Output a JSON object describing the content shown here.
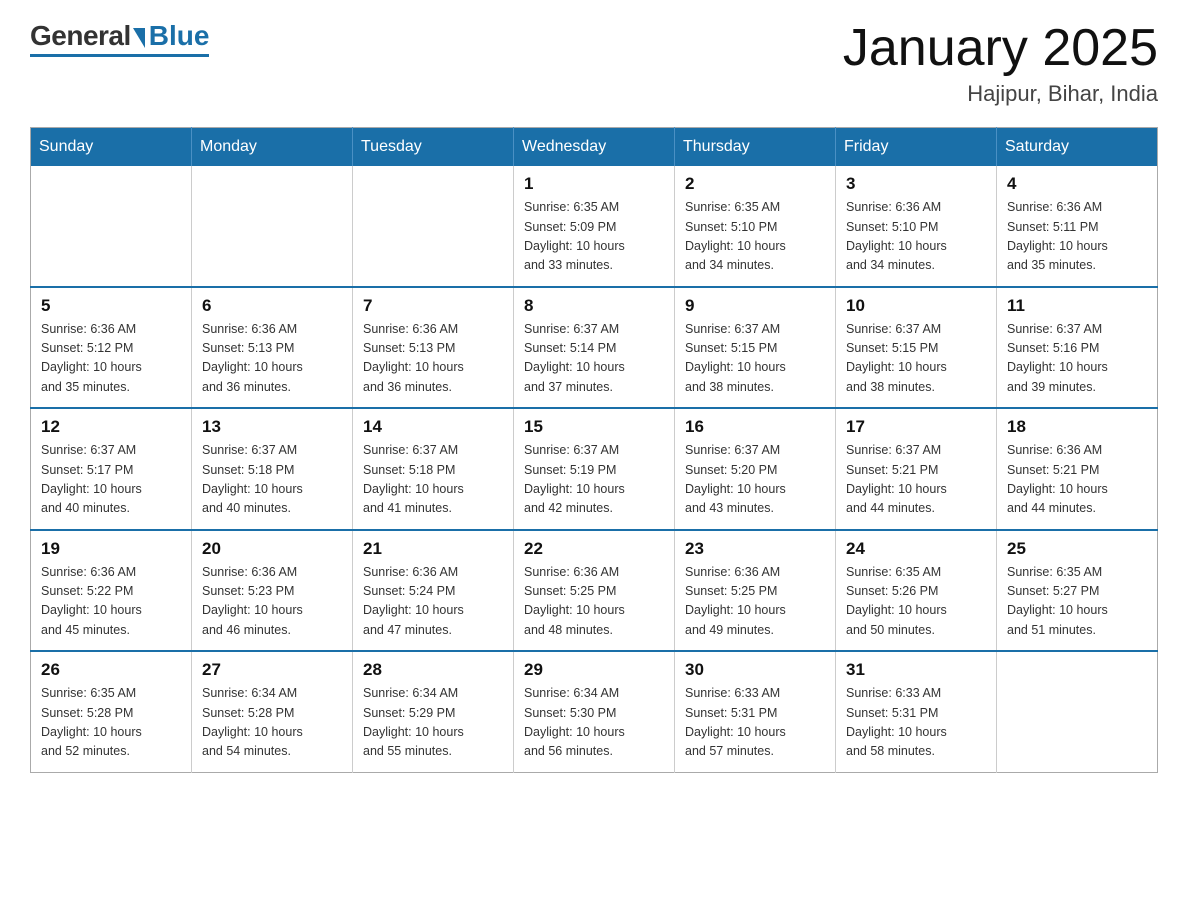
{
  "header": {
    "logo": {
      "general": "General",
      "blue": "Blue"
    },
    "title": "January 2025",
    "subtitle": "Hajipur, Bihar, India"
  },
  "calendar": {
    "days_of_week": [
      "Sunday",
      "Monday",
      "Tuesday",
      "Wednesday",
      "Thursday",
      "Friday",
      "Saturday"
    ],
    "weeks": [
      [
        {
          "day": "",
          "info": ""
        },
        {
          "day": "",
          "info": ""
        },
        {
          "day": "",
          "info": ""
        },
        {
          "day": "1",
          "info": "Sunrise: 6:35 AM\nSunset: 5:09 PM\nDaylight: 10 hours\nand 33 minutes."
        },
        {
          "day": "2",
          "info": "Sunrise: 6:35 AM\nSunset: 5:10 PM\nDaylight: 10 hours\nand 34 minutes."
        },
        {
          "day": "3",
          "info": "Sunrise: 6:36 AM\nSunset: 5:10 PM\nDaylight: 10 hours\nand 34 minutes."
        },
        {
          "day": "4",
          "info": "Sunrise: 6:36 AM\nSunset: 5:11 PM\nDaylight: 10 hours\nand 35 minutes."
        }
      ],
      [
        {
          "day": "5",
          "info": "Sunrise: 6:36 AM\nSunset: 5:12 PM\nDaylight: 10 hours\nand 35 minutes."
        },
        {
          "day": "6",
          "info": "Sunrise: 6:36 AM\nSunset: 5:13 PM\nDaylight: 10 hours\nand 36 minutes."
        },
        {
          "day": "7",
          "info": "Sunrise: 6:36 AM\nSunset: 5:13 PM\nDaylight: 10 hours\nand 36 minutes."
        },
        {
          "day": "8",
          "info": "Sunrise: 6:37 AM\nSunset: 5:14 PM\nDaylight: 10 hours\nand 37 minutes."
        },
        {
          "day": "9",
          "info": "Sunrise: 6:37 AM\nSunset: 5:15 PM\nDaylight: 10 hours\nand 38 minutes."
        },
        {
          "day": "10",
          "info": "Sunrise: 6:37 AM\nSunset: 5:15 PM\nDaylight: 10 hours\nand 38 minutes."
        },
        {
          "day": "11",
          "info": "Sunrise: 6:37 AM\nSunset: 5:16 PM\nDaylight: 10 hours\nand 39 minutes."
        }
      ],
      [
        {
          "day": "12",
          "info": "Sunrise: 6:37 AM\nSunset: 5:17 PM\nDaylight: 10 hours\nand 40 minutes."
        },
        {
          "day": "13",
          "info": "Sunrise: 6:37 AM\nSunset: 5:18 PM\nDaylight: 10 hours\nand 40 minutes."
        },
        {
          "day": "14",
          "info": "Sunrise: 6:37 AM\nSunset: 5:18 PM\nDaylight: 10 hours\nand 41 minutes."
        },
        {
          "day": "15",
          "info": "Sunrise: 6:37 AM\nSunset: 5:19 PM\nDaylight: 10 hours\nand 42 minutes."
        },
        {
          "day": "16",
          "info": "Sunrise: 6:37 AM\nSunset: 5:20 PM\nDaylight: 10 hours\nand 43 minutes."
        },
        {
          "day": "17",
          "info": "Sunrise: 6:37 AM\nSunset: 5:21 PM\nDaylight: 10 hours\nand 44 minutes."
        },
        {
          "day": "18",
          "info": "Sunrise: 6:36 AM\nSunset: 5:21 PM\nDaylight: 10 hours\nand 44 minutes."
        }
      ],
      [
        {
          "day": "19",
          "info": "Sunrise: 6:36 AM\nSunset: 5:22 PM\nDaylight: 10 hours\nand 45 minutes."
        },
        {
          "day": "20",
          "info": "Sunrise: 6:36 AM\nSunset: 5:23 PM\nDaylight: 10 hours\nand 46 minutes."
        },
        {
          "day": "21",
          "info": "Sunrise: 6:36 AM\nSunset: 5:24 PM\nDaylight: 10 hours\nand 47 minutes."
        },
        {
          "day": "22",
          "info": "Sunrise: 6:36 AM\nSunset: 5:25 PM\nDaylight: 10 hours\nand 48 minutes."
        },
        {
          "day": "23",
          "info": "Sunrise: 6:36 AM\nSunset: 5:25 PM\nDaylight: 10 hours\nand 49 minutes."
        },
        {
          "day": "24",
          "info": "Sunrise: 6:35 AM\nSunset: 5:26 PM\nDaylight: 10 hours\nand 50 minutes."
        },
        {
          "day": "25",
          "info": "Sunrise: 6:35 AM\nSunset: 5:27 PM\nDaylight: 10 hours\nand 51 minutes."
        }
      ],
      [
        {
          "day": "26",
          "info": "Sunrise: 6:35 AM\nSunset: 5:28 PM\nDaylight: 10 hours\nand 52 minutes."
        },
        {
          "day": "27",
          "info": "Sunrise: 6:34 AM\nSunset: 5:28 PM\nDaylight: 10 hours\nand 54 minutes."
        },
        {
          "day": "28",
          "info": "Sunrise: 6:34 AM\nSunset: 5:29 PM\nDaylight: 10 hours\nand 55 minutes."
        },
        {
          "day": "29",
          "info": "Sunrise: 6:34 AM\nSunset: 5:30 PM\nDaylight: 10 hours\nand 56 minutes."
        },
        {
          "day": "30",
          "info": "Sunrise: 6:33 AM\nSunset: 5:31 PM\nDaylight: 10 hours\nand 57 minutes."
        },
        {
          "day": "31",
          "info": "Sunrise: 6:33 AM\nSunset: 5:31 PM\nDaylight: 10 hours\nand 58 minutes."
        },
        {
          "day": "",
          "info": ""
        }
      ]
    ]
  }
}
